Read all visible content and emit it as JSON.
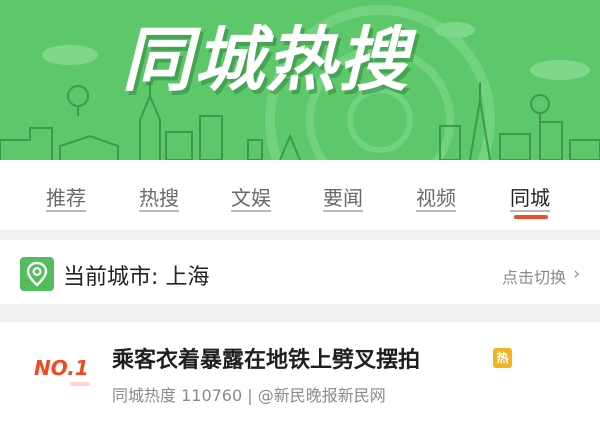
{
  "banner": {
    "title": "同城热搜"
  },
  "tabs": [
    {
      "label": "推荐"
    },
    {
      "label": "热搜"
    },
    {
      "label": "文娱"
    },
    {
      "label": "要闻"
    },
    {
      "label": "视频"
    },
    {
      "label": "同城"
    }
  ],
  "active_tab": "同城",
  "city_bar": {
    "label": "当前城市: 上海",
    "switch_label": "点击切换",
    "chevron": "›",
    "icon": "location-pin-icon"
  },
  "items": [
    {
      "rank": "NO.1",
      "title": "乘客衣着暴露在地铁上劈叉摆拍",
      "badge": "热",
      "meta": "同城热度 110760 | @新民晚报新民网"
    }
  ],
  "colors": {
    "banner_bg": "#5cc86a",
    "accent": "#f04d28",
    "hot_badge": "#f3b21f",
    "pin_bg": "#53bd5e"
  }
}
